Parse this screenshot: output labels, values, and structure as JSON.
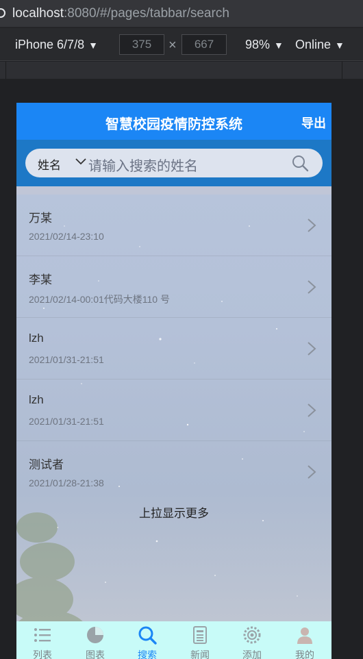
{
  "browser": {
    "url_host": "localhost",
    "url_rest": ":8080/#/pages/tabbar/search",
    "device": "iPhone 6/7/8",
    "width": "375",
    "height": "667",
    "zoom": "98%",
    "network": "Online"
  },
  "app": {
    "title": "智慧校园疫情防控系统",
    "export_label": "导出"
  },
  "search": {
    "field": "姓名",
    "placeholder": "请输入搜索的姓名"
  },
  "records": [
    {
      "name": "万某",
      "meta": "2021/02/14-23:10"
    },
    {
      "name": "李某",
      "meta": "2021/02/14-00:01代码大楼110 号"
    },
    {
      "name": "lzh",
      "meta": "2021/01/31-21:51"
    },
    {
      "name": "lzh",
      "meta": "2021/01/31-21:51"
    },
    {
      "name": "测试者",
      "meta": "2021/01/28-21:38"
    }
  ],
  "load_more": "上拉显示更多",
  "tabs": [
    {
      "label": "列表",
      "icon": "list-icon"
    },
    {
      "label": "图表",
      "icon": "pie-chart-icon"
    },
    {
      "label": "搜索",
      "icon": "search-icon",
      "active": true
    },
    {
      "label": "新闻",
      "icon": "news-icon"
    },
    {
      "label": "添加",
      "icon": "add-gear-icon"
    },
    {
      "label": "我的",
      "icon": "user-icon"
    }
  ],
  "colors": {
    "primary": "#1b86f5",
    "tabbar_bg": "#c8fbf8",
    "search_band": "#1d78c6"
  }
}
